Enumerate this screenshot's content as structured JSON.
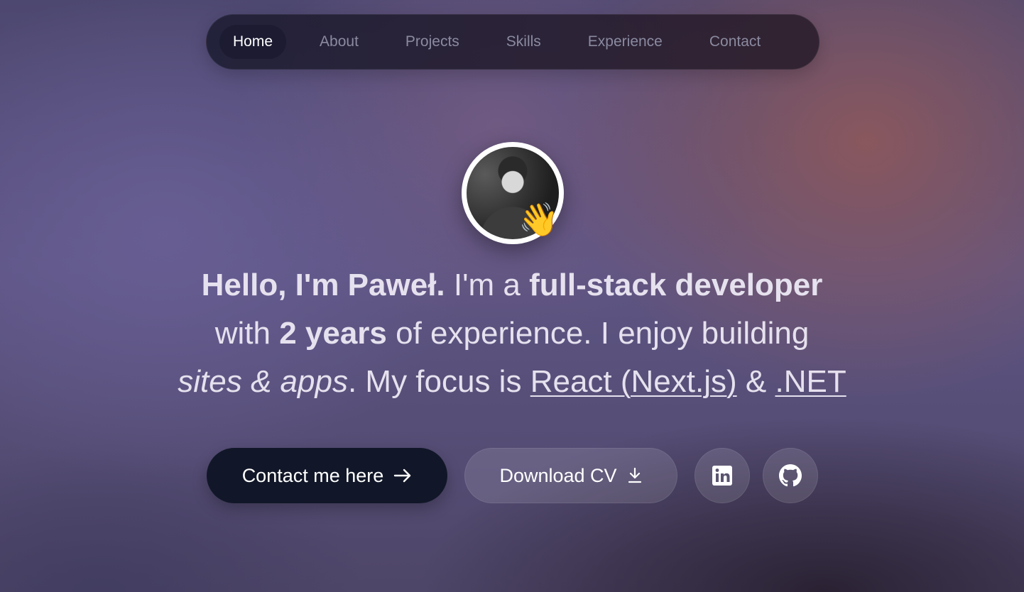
{
  "nav": {
    "items": [
      {
        "label": "Home",
        "active": true
      },
      {
        "label": "About",
        "active": false
      },
      {
        "label": "Projects",
        "active": false
      },
      {
        "label": "Skills",
        "active": false
      },
      {
        "label": "Experience",
        "active": false
      },
      {
        "label": "Contact",
        "active": false
      }
    ]
  },
  "hero": {
    "avatar_icon": "profile-photo",
    "wave_emoji": "👋",
    "greeting": "Hello, I'm Paweł.",
    "intro_prefix": "I'm a",
    "role": "full-stack developer",
    "with_text": "with",
    "years": "2 years",
    "experience_text": "of experience. I enjoy building",
    "sites_apps": "sites & apps",
    "focus_text": ". My focus is",
    "tech1": "React (Next.js)",
    "amp": "&",
    "tech2": ".NET"
  },
  "actions": {
    "contact_label": "Contact me here",
    "contact_icon": "arrow-right-icon",
    "cv_label": "Download CV",
    "cv_icon": "download-icon",
    "linkedin_icon": "linkedin-icon",
    "github_icon": "github-icon"
  },
  "colors": {
    "text": "#e6e1ee",
    "nav_active": "#ffffff",
    "nav_inactive": "#8a8aa0",
    "primary_button": "#111728"
  }
}
